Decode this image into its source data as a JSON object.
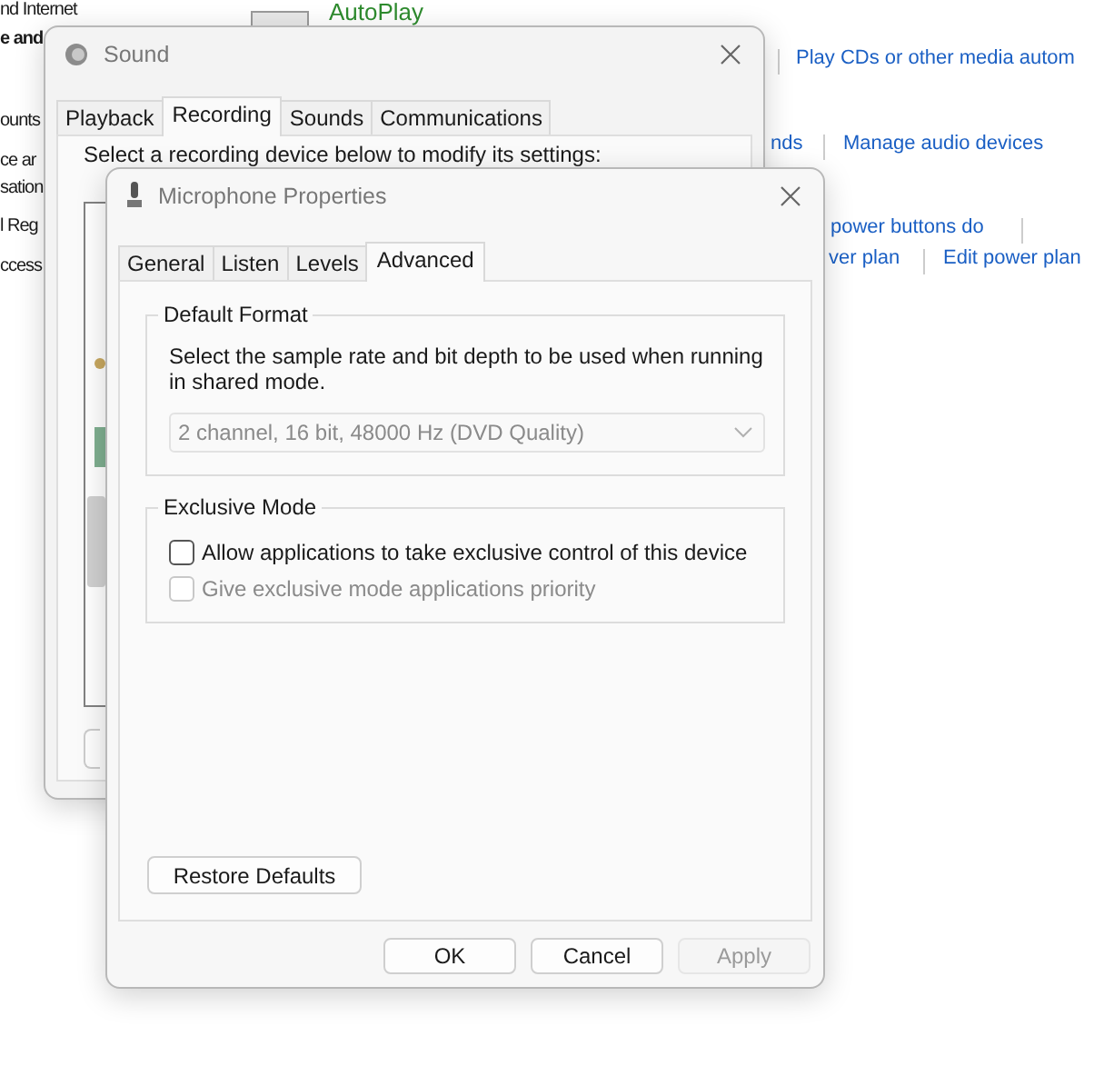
{
  "background": {
    "items": [
      {
        "text": "nd Internet",
        "kind": "plain"
      },
      {
        "text": "e and",
        "kind": "bold"
      },
      {
        "text": "ounts",
        "kind": "plain"
      },
      {
        "text": "ce ar",
        "kind": "plain"
      },
      {
        "text": "sation",
        "kind": "plain"
      },
      {
        "text": "l Reg",
        "kind": "plain"
      },
      {
        "text": "ccess",
        "kind": "plain"
      },
      {
        "text": "AutoPlay",
        "kind": "heading"
      },
      {
        "text": "Play CDs or other media autom",
        "kind": "link"
      },
      {
        "text": "nds",
        "kind": "link"
      },
      {
        "text": "Manage audio devices",
        "kind": "link"
      },
      {
        "text": "power buttons do",
        "kind": "link"
      },
      {
        "text": "ver plan",
        "kind": "link"
      },
      {
        "text": "Edit power plan",
        "kind": "link"
      }
    ]
  },
  "sound_window": {
    "title": "Sound",
    "tabs": [
      {
        "label": "Playback",
        "selected": false
      },
      {
        "label": "Recording",
        "selected": true
      },
      {
        "label": "Sounds",
        "selected": false
      },
      {
        "label": "Communications",
        "selected": false
      }
    ],
    "instruction": "Select a recording device below to modify its settings:"
  },
  "microphone_window": {
    "title": "Microphone Properties",
    "tabs": [
      {
        "label": "General",
        "selected": false
      },
      {
        "label": "Listen",
        "selected": false
      },
      {
        "label": "Levels",
        "selected": false
      },
      {
        "label": "Advanced",
        "selected": true
      }
    ],
    "default_format": {
      "heading": "Default Format",
      "description": "Select the sample rate and bit depth to be used when running in shared mode.",
      "dropdown": {
        "value": "2 channel, 16 bit, 48000 Hz (DVD Quality)",
        "disabled": true
      }
    },
    "exclusive_mode": {
      "heading": "Exclusive Mode",
      "options": [
        {
          "label": "Allow applications to take exclusive control of this device",
          "checked": false,
          "disabled": false
        },
        {
          "label": "Give exclusive mode applications priority",
          "checked": false,
          "disabled": true
        }
      ]
    },
    "restore_button": "Restore Defaults",
    "buttons": [
      {
        "label": "OK",
        "disabled": false
      },
      {
        "label": "Cancel",
        "disabled": false
      },
      {
        "label": "Apply",
        "disabled": true
      }
    ]
  }
}
